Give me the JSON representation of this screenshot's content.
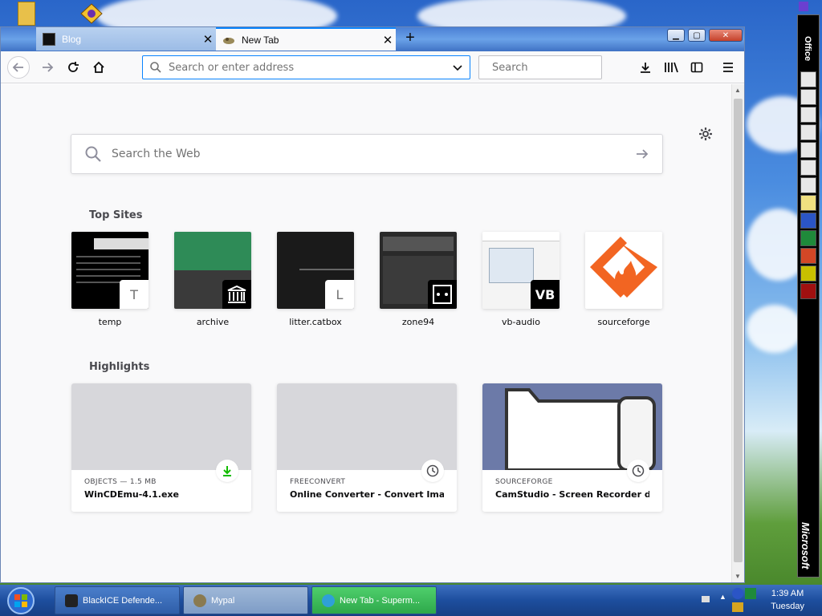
{
  "browser": {
    "tabs": [
      {
        "label": "Blog",
        "active": false
      },
      {
        "label": "New Tab",
        "active": true
      }
    ],
    "nav": {
      "address_placeholder": "Search or enter address",
      "search_placeholder": "Search"
    }
  },
  "newtab": {
    "web_search_placeholder": "Search the Web",
    "top_sites_title": "Top Sites",
    "top_sites": [
      {
        "label": "temp",
        "badge": "T"
      },
      {
        "label": "archive",
        "badge": ""
      },
      {
        "label": "litter.catbox",
        "badge": "L"
      },
      {
        "label": "zone94",
        "badge": ""
      },
      {
        "label": "vb-audio",
        "badge": ""
      },
      {
        "label": "sourceforge",
        "badge": ""
      }
    ],
    "highlights_title": "Highlights",
    "highlights": [
      {
        "source": "OBJECTS — 1.5 MB",
        "title": "WinCDEmu-4.1.exe",
        "icon": "download-icon"
      },
      {
        "source": "FREECONVERT",
        "title": "Online Converter - Convert Ima...",
        "icon": "clock-icon"
      },
      {
        "source": "SOURCEFORGE",
        "title": "CamStudio - Screen Recorder d...",
        "icon": "clock-icon"
      }
    ]
  },
  "taskbar": {
    "items": [
      {
        "label": "BlackICE Defende..."
      },
      {
        "label": "Mypal"
      },
      {
        "label": "New Tab - Superm..."
      }
    ],
    "clock_time": "1:39 AM",
    "clock_day": "Tuesday"
  },
  "officebar": {
    "title": "Office",
    "brand": "Microsoft"
  }
}
